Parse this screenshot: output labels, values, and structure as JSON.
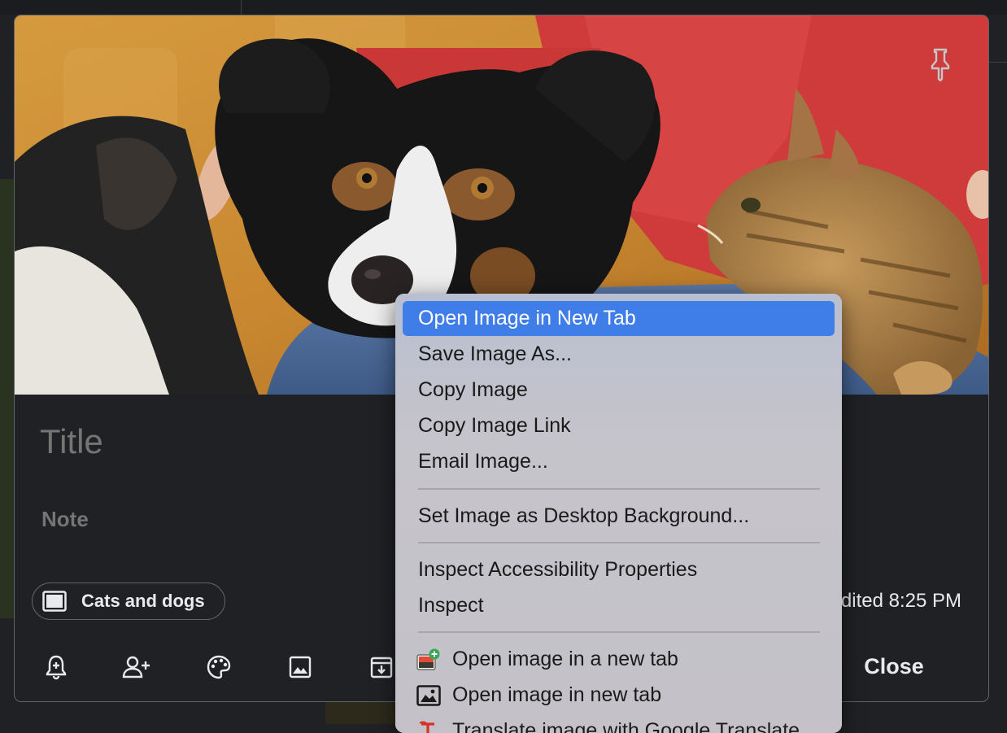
{
  "note": {
    "title_placeholder": "Title",
    "note_placeholder": "Note",
    "label_chip": "Cats and dogs",
    "edited_text": "Edited 8:25 PM",
    "close_label": "Close"
  },
  "context_menu": {
    "items": [
      {
        "label": "Open Image in New Tab",
        "highlighted": true
      },
      {
        "label": "Save Image As..."
      },
      {
        "label": "Copy Image"
      },
      {
        "label": "Copy Image Link"
      },
      {
        "label": "Email Image..."
      },
      {
        "label": "Set Image as Desktop Background..."
      },
      {
        "label": "Inspect Accessibility Properties"
      },
      {
        "label": "Inspect"
      },
      {
        "label": "Open image in a new tab",
        "icon": "image-plus-icon"
      },
      {
        "label": "Open image in new tab",
        "icon": "image-frame-icon"
      },
      {
        "label": "Translate image with Google Translate",
        "icon": "google-translate-icon"
      }
    ]
  },
  "colors": {
    "highlight": "#3f7de9",
    "background": "#202124",
    "menu_bg": "#c3c2ca"
  },
  "icons": [
    "pin-icon",
    "add-reminder-icon",
    "collaborator-icon",
    "palette-icon",
    "add-image-icon",
    "archive-icon",
    "label-icon"
  ]
}
